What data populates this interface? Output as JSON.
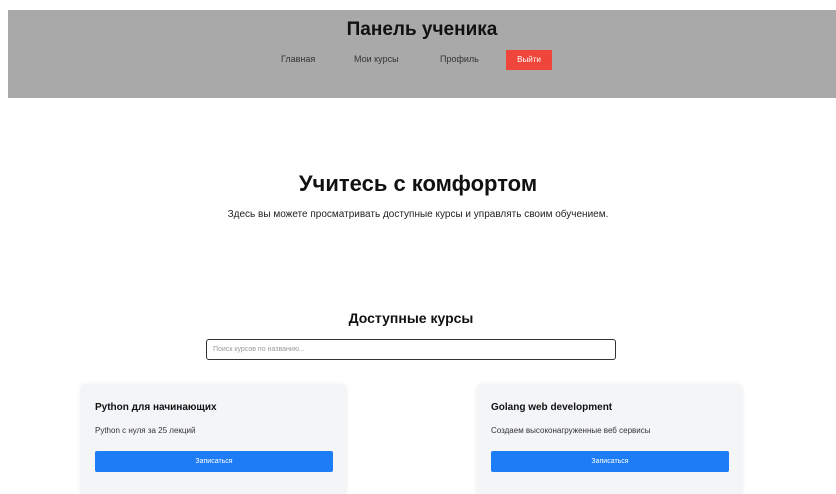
{
  "header": {
    "title": "Панель ученика",
    "nav": [
      {
        "label": "Главная"
      },
      {
        "label": "Мои курсы"
      },
      {
        "label": "Профиль"
      }
    ],
    "logout_label": "Выйти"
  },
  "hero": {
    "title": "Учитесь с комфортом",
    "text": "Здесь вы можете просматривать доступные курсы и управлять своим обучением."
  },
  "courses_section": {
    "title": "Доступные курсы",
    "search": {
      "placeholder": "Поиск курсов по названию...",
      "value": ""
    },
    "courses": [
      {
        "name": "Python для начинающих",
        "description": "Python с нуля за 25 лекций",
        "button_label": "Записаться"
      },
      {
        "name": "Golang web development",
        "description": "Создаем высоконагруженные веб сервисы",
        "button_label": "Записаться"
      }
    ]
  },
  "colors": {
    "header_bg": "#a9a9a9",
    "logout_button": "#f0453a",
    "primary_button": "#1f7cf7",
    "card_bg": "#f4f5f7"
  }
}
